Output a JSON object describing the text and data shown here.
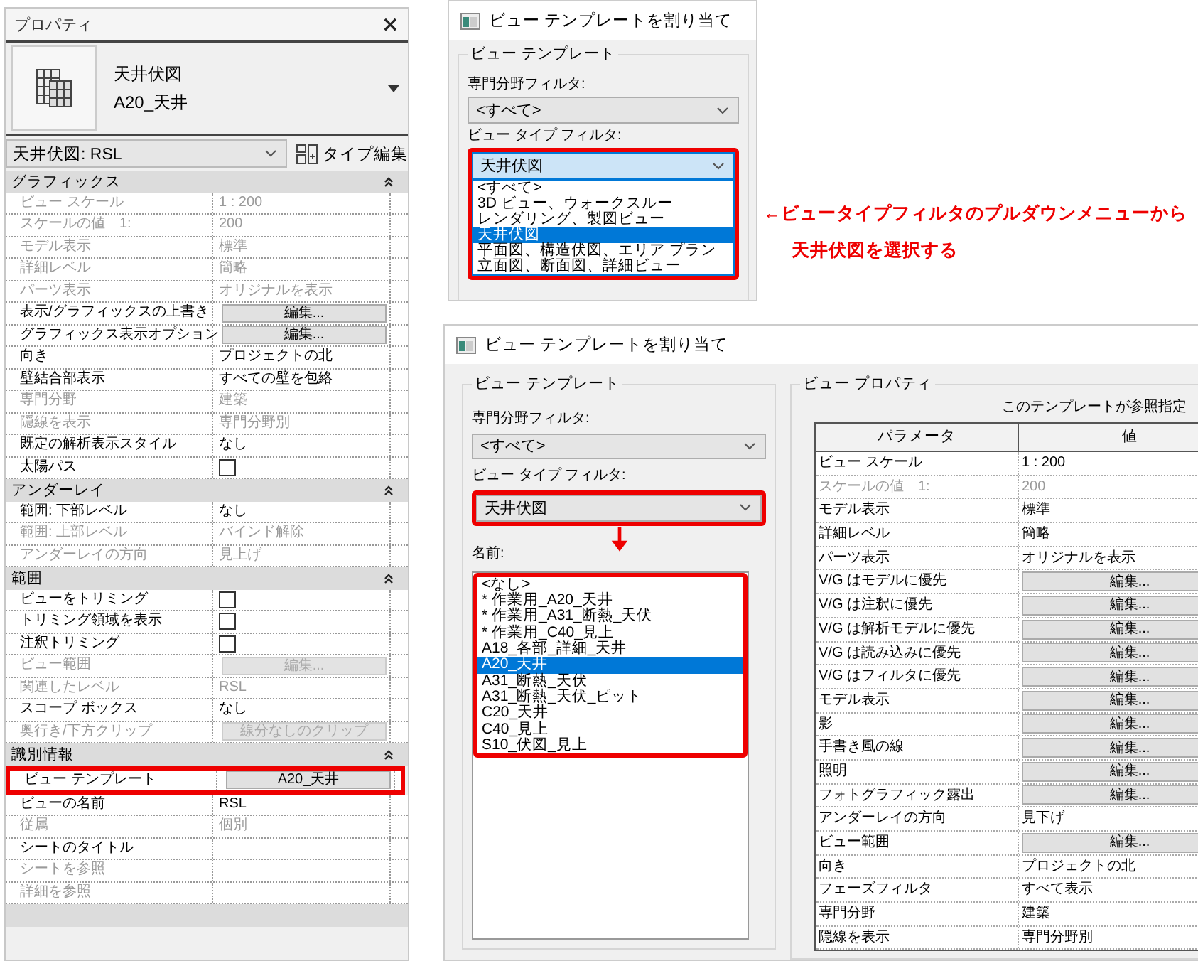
{
  "properties_panel": {
    "title": "プロパティ",
    "close": "×",
    "type_name": "天井伏図",
    "type_template": "A20_天井",
    "type_selector": "天井伏図: RSL",
    "type_edit_button": "タイプ編集",
    "sections": [
      {
        "title": "グラフィックス",
        "rows": [
          {
            "label": "ビュー スケール",
            "kind": "text",
            "value": "1 : 200",
            "disabled": true
          },
          {
            "label": "スケールの値　1:",
            "kind": "text",
            "value": "200",
            "disabled": true
          },
          {
            "label": "モデル表示",
            "kind": "text",
            "value": "標準",
            "disabled": true
          },
          {
            "label": "詳細レベル",
            "kind": "text",
            "value": "簡略",
            "disabled": true
          },
          {
            "label": "パーツ表示",
            "kind": "text",
            "value": "オリジナルを表示",
            "disabled": true
          },
          {
            "label": "表示/グラフィックスの上書き",
            "kind": "button",
            "value": "編集...",
            "disabled": false
          },
          {
            "label": "グラフィックス表示オプション",
            "kind": "button",
            "value": "編集...",
            "disabled": false
          },
          {
            "label": "向き",
            "kind": "text",
            "value": "プロジェクトの北",
            "disabled": false
          },
          {
            "label": "壁結合部表示",
            "kind": "text",
            "value": "すべての壁を包絡",
            "disabled": false
          },
          {
            "label": "専門分野",
            "kind": "text",
            "value": "建築",
            "disabled": true
          },
          {
            "label": "隠線を表示",
            "kind": "text",
            "value": "専門分野別",
            "disabled": true
          },
          {
            "label": "既定の解析表示スタイル",
            "kind": "text",
            "value": "なし",
            "disabled": false
          },
          {
            "label": "太陽パス",
            "kind": "checkbox",
            "checked": false,
            "disabled": false
          }
        ]
      },
      {
        "title": "アンダーレイ",
        "rows": [
          {
            "label": "範囲: 下部レベル",
            "kind": "text",
            "value": "なし",
            "disabled": false
          },
          {
            "label": "範囲: 上部レベル",
            "kind": "text",
            "value": "バインド解除",
            "disabled": true
          },
          {
            "label": "アンダーレイの方向",
            "kind": "text",
            "value": "見上げ",
            "disabled": true
          }
        ]
      },
      {
        "title": "範囲",
        "rows": [
          {
            "label": "ビューをトリミング",
            "kind": "checkbox",
            "checked": false,
            "disabled": false
          },
          {
            "label": "トリミング領域を表示",
            "kind": "checkbox",
            "checked": false,
            "disabled": false
          },
          {
            "label": "注釈トリミング",
            "kind": "checkbox",
            "checked": false,
            "disabled": false
          },
          {
            "label": "ビュー範囲",
            "kind": "button",
            "value": "編集...",
            "disabled": true
          },
          {
            "label": "関連したレベル",
            "kind": "text",
            "value": "RSL",
            "disabled": true
          },
          {
            "label": "スコープ ボックス",
            "kind": "text",
            "value": "なし",
            "disabled": false
          },
          {
            "label": "奥行き/下方クリップ",
            "kind": "button",
            "value": "線分なしのクリップ",
            "disabled": true
          }
        ]
      },
      {
        "title": "識別情報",
        "rows": [
          {
            "label": "ビュー テンプレート",
            "kind": "button",
            "value": "A20_天井",
            "disabled": false,
            "highlighted": true
          },
          {
            "label": "ビューの名前",
            "kind": "text",
            "value": "RSL",
            "disabled": false,
            "highlighted": false
          },
          {
            "label": "従属",
            "kind": "text",
            "value": "個別",
            "disabled": true,
            "highlighted": false
          },
          {
            "label": "シートのタイトル",
            "kind": "text",
            "disabled": false,
            "highlighted": false
          },
          {
            "label": "シートを参照",
            "kind": "text",
            "disabled": true,
            "highlighted": false
          },
          {
            "label": "詳細を参照",
            "kind": "text",
            "disabled": true,
            "highlighted": false
          }
        ]
      }
    ]
  },
  "dialog_top": {
    "title": "ビュー テンプレートを割り当て",
    "group": "ビュー テンプレート",
    "discipline_label": "専門分野フィルタ:",
    "discipline_value": "<すべて>",
    "view_type_label": "ビュー タイプ フィルタ:",
    "view_type_value": "天井伏図",
    "expanded": true,
    "highlighted": true,
    "options": [
      {
        "label": "<すべて>",
        "selected": false
      },
      {
        "label": "3D ビュー、ウォークスルー",
        "selected": false
      },
      {
        "label": "レンダリング、製図ビュー",
        "selected": false
      },
      {
        "label": "天井伏図",
        "selected": true
      },
      {
        "label": "平面図、構造伏図、エリア プラン",
        "selected": false
      },
      {
        "label": "立面図、断面図、詳細ビュー",
        "selected": false
      }
    ]
  },
  "callout": {
    "lines": [
      "←ビュータイプフィルタのプルダウンメニューから",
      "天井伏図を選択する"
    ]
  },
  "dialog_bottom": {
    "title": "ビュー テンプレートを割り当て",
    "group": "ビュー テンプレート",
    "discipline_label": "専門分野フィルタ:",
    "discipline_value": "<すべて>",
    "view_type_label": "ビュー タイプ フィルタ:",
    "view_type_value": "天井伏図",
    "expanded": false,
    "highlighted": true,
    "name_label": "名前:",
    "names_highlighted": true,
    "names": [
      {
        "label": "<なし>",
        "selected": false
      },
      {
        "label": "* 作業用_A20_天井",
        "selected": false
      },
      {
        "label": "* 作業用_A31_断熱_天伏",
        "selected": false
      },
      {
        "label": "* 作業用_C40_見上",
        "selected": false
      },
      {
        "label": "A18_各部_詳細_天井",
        "selected": false
      },
      {
        "label": "A20_天井",
        "selected": true
      },
      {
        "label": "A31_断熱_天伏",
        "selected": false
      },
      {
        "label": "A31_断熱_天伏_ピット",
        "selected": false
      },
      {
        "label": "C20_天井",
        "selected": false
      },
      {
        "label": "C40_見上",
        "selected": false
      },
      {
        "label": "S10_伏図_見上",
        "selected": false
      }
    ],
    "properties_group": "ビュー プロパティ",
    "note": "このテンプレートが参照指定",
    "columns": [
      "パラメータ",
      "値"
    ],
    "rows": [
      {
        "label": "ビュー スケール",
        "kind": "text",
        "value": "1 : 200",
        "disabled": false
      },
      {
        "label": "スケールの値　1:",
        "kind": "text",
        "value": "200",
        "disabled": true
      },
      {
        "label": "モデル表示",
        "kind": "text",
        "value": "標準",
        "disabled": false
      },
      {
        "label": "詳細レベル",
        "kind": "text",
        "value": "簡略",
        "disabled": false
      },
      {
        "label": "パーツ表示",
        "kind": "text",
        "value": "オリジナルを表示",
        "disabled": false
      },
      {
        "label": "V/G はモデルに優先",
        "kind": "button",
        "value": "編集...",
        "disabled": false
      },
      {
        "label": "V/G は注釈に優先",
        "kind": "button",
        "value": "編集...",
        "disabled": false
      },
      {
        "label": "V/G は解析モデルに優先",
        "kind": "button",
        "value": "編集...",
        "disabled": false
      },
      {
        "label": "V/G は読み込みに優先",
        "kind": "button",
        "value": "編集...",
        "disabled": false
      },
      {
        "label": "V/G はフィルタに優先",
        "kind": "button",
        "value": "編集...",
        "disabled": false
      },
      {
        "label": "モデル表示",
        "kind": "button",
        "value": "編集...",
        "disabled": false
      },
      {
        "label": "影",
        "kind": "button",
        "value": "編集...",
        "disabled": false
      },
      {
        "label": "手書き風の線",
        "kind": "button",
        "value": "編集...",
        "disabled": false
      },
      {
        "label": "照明",
        "kind": "button",
        "value": "編集...",
        "disabled": false
      },
      {
        "label": "フォトグラフィック露出",
        "kind": "button",
        "value": "編集...",
        "disabled": false
      },
      {
        "label": "アンダーレイの方向",
        "kind": "text",
        "value": "見下げ",
        "disabled": false
      },
      {
        "label": "ビュー範囲",
        "kind": "button",
        "value": "編集...",
        "disabled": false
      },
      {
        "label": "向き",
        "kind": "text",
        "value": "プロジェクトの北",
        "disabled": false
      },
      {
        "label": "フェーズフィルタ",
        "kind": "text",
        "value": "すべて表示",
        "disabled": false
      },
      {
        "label": "専門分野",
        "kind": "text",
        "value": "建築",
        "disabled": false
      },
      {
        "label": "隠線を表示",
        "kind": "text",
        "value": "専門分野別",
        "disabled": false
      }
    ]
  }
}
